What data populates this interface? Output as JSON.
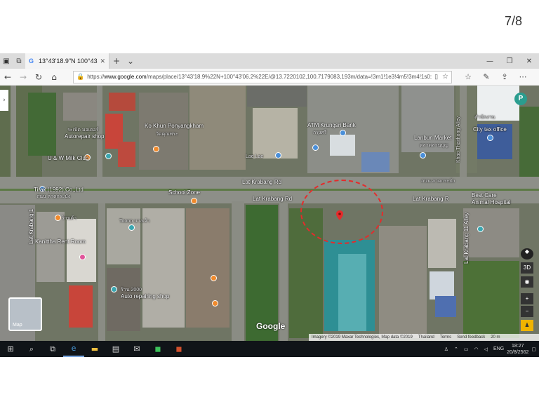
{
  "slide_counter": "7/8",
  "browser": {
    "tab_title": "13°43'18.9\"N 100°43'06",
    "tab_favicon": "G",
    "url_prefix": "https://",
    "url_host": "www.google.com",
    "url_path": "/maps/place/13°43'18.9%22N+100°43'06.2%22E/@13.7220102,100.7179083,193m/data=!3m1!1e3!4m5!3m4!1s0:0x0!8m2"
  },
  "map": {
    "labels": {
      "lat_krabang_rd_1": "Lat Krabang Rd",
      "lat_krabang_rd_2": "Lat Krabang Rd",
      "lat_krabang_rd_3": "Lat Krabang R",
      "lat_krabang_rd_v1": "Lat Krabang 1",
      "lat_krabang_rd_v2": "Lat Krabang 11 Alley",
      "khao_thaithong": "Khao Thaithong Alley",
      "thanon_thai": "ถนน ลาดกระบัง",
      "tirak": "Tirak (1992) Co.,Ltd",
      "tirak_th": "ถนน ลาดกระบัง",
      "school_zone": "School Zone",
      "ko_khun": "Ko Khun Ponyangkham",
      "ko_khun_th": "วัดคุณพระ",
      "autorepair": "Autorepair shop",
      "autorepair_th": "ระเบิด มอเตอร์",
      "uu_milk": "U & W Milk Club",
      "atm_krungsri": "ATM Krungsri Bank",
      "atm_th": "กรุงศรี",
      "lanbun": "Lanbun Market",
      "lanbun_th": "ตลาดลานบุญ",
      "city_tax": "City tax office",
      "city_tax_th": "สำนักงาน",
      "bestcare": "Best Care",
      "animal_hospital": "Animal Hospital",
      "kanittha": "Kanittha Rent Room",
      "auto_repairing": "Auto repairing shop",
      "lae_lae": "Lae Lae",
      "toonp": "Toonp นางเจ้า",
      "sign_7": "ร้านค้า",
      "thai_small": "ร้าน 2000"
    },
    "minimap_label": "Map",
    "google_logo": "Google",
    "parking_letter": "P",
    "control_3d": "3D",
    "attribution": {
      "imagery": "Imagery ©2019 Maxar Technologies, Map data ©2019",
      "thailand": "Thailand",
      "terms": "Terms",
      "feedback": "Send feedback",
      "scale": "20 m"
    },
    "pin_colors": {
      "orange": "#f08a2c",
      "blue": "#4a8fd9",
      "pink": "#e0559a",
      "red": "#e52b2b"
    }
  },
  "taskbar": {
    "lang": "ENG",
    "time": "18:27",
    "date": "20/8/2562"
  }
}
